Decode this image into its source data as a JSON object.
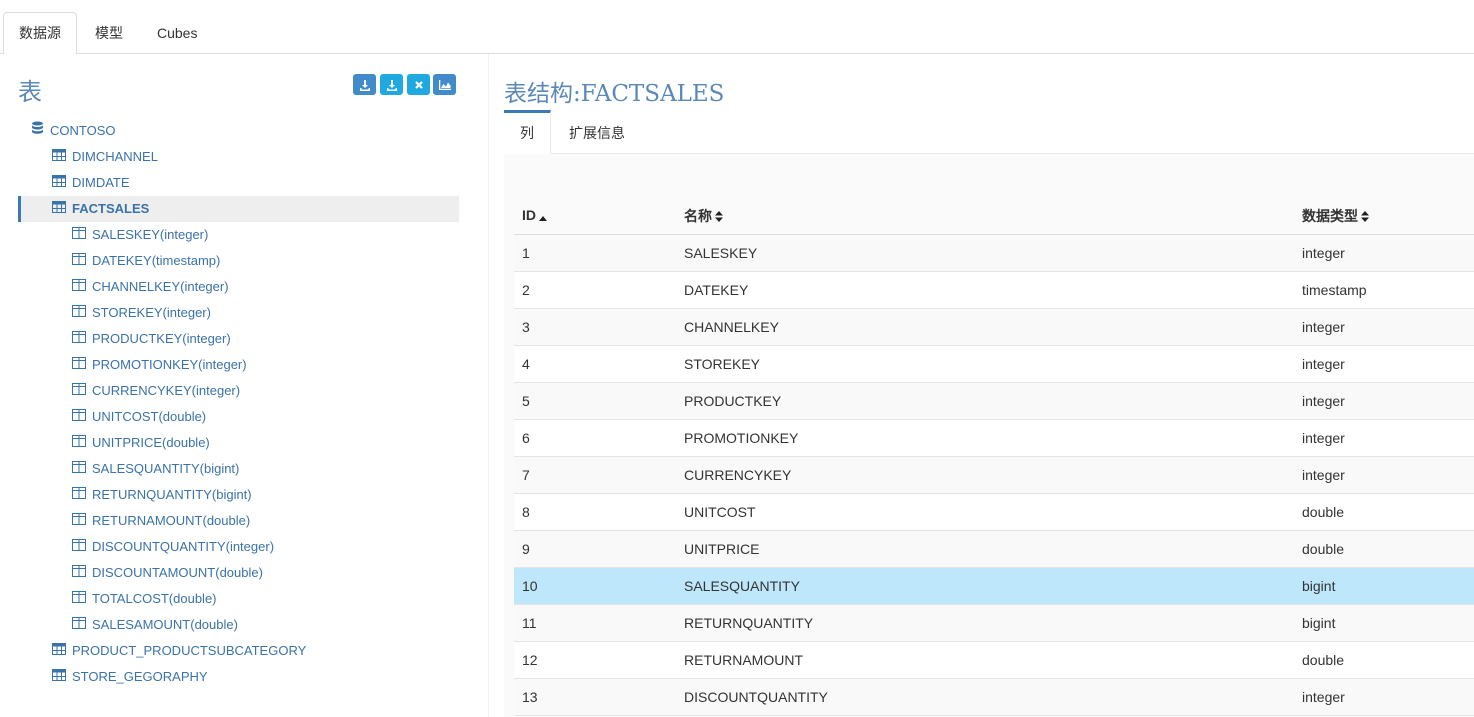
{
  "top_tabs": [
    "数据源",
    "模型",
    "Cubes"
  ],
  "left": {
    "title": "表",
    "toolbar": [
      {
        "name": "import-button",
        "color": "#428bca",
        "icon": "download-icon"
      },
      {
        "name": "download-button",
        "color": "#1fa9e0",
        "icon": "download-icon"
      },
      {
        "name": "delete-button",
        "color": "#1fa9e0",
        "icon": "close-icon"
      },
      {
        "name": "chart-button",
        "color": "#428bca",
        "icon": "area-chart-icon"
      }
    ],
    "tree": {
      "database": "CONTOSO",
      "tables_before": [
        "DIMCHANNEL",
        "DIMDATE"
      ],
      "selected_table": "FACTSALES",
      "columns": [
        "SALESKEY(integer)",
        "DATEKEY(timestamp)",
        "CHANNELKEY(integer)",
        "STOREKEY(integer)",
        "PRODUCTKEY(integer)",
        "PROMOTIONKEY(integer)",
        "CURRENCYKEY(integer)",
        "UNITCOST(double)",
        "UNITPRICE(double)",
        "SALESQUANTITY(bigint)",
        "RETURNQUANTITY(bigint)",
        "RETURNAMOUNT(double)",
        "DISCOUNTQUANTITY(integer)",
        "DISCOUNTAMOUNT(double)",
        "TOTALCOST(double)",
        "SALESAMOUNT(double)"
      ],
      "tables_after": [
        "PRODUCT_PRODUCTSUBCATEGORY",
        "STORE_GEGORAPHY"
      ]
    }
  },
  "right": {
    "title": "表结构:FACTSALES",
    "tabs": [
      "列",
      "扩展信息"
    ],
    "table": {
      "headers": [
        "ID",
        "名称",
        "数据类型"
      ],
      "highlight_row": 10,
      "rows": [
        [
          "1",
          "SALESKEY",
          "integer"
        ],
        [
          "2",
          "DATEKEY",
          "timestamp"
        ],
        [
          "3",
          "CHANNELKEY",
          "integer"
        ],
        [
          "4",
          "STOREKEY",
          "integer"
        ],
        [
          "5",
          "PRODUCTKEY",
          "integer"
        ],
        [
          "6",
          "PROMOTIONKEY",
          "integer"
        ],
        [
          "7",
          "CURRENCYKEY",
          "integer"
        ],
        [
          "8",
          "UNITCOST",
          "double"
        ],
        [
          "9",
          "UNITPRICE",
          "double"
        ],
        [
          "10",
          "SALESQUANTITY",
          "bigint"
        ],
        [
          "11",
          "RETURNQUANTITY",
          "bigint"
        ],
        [
          "12",
          "RETURNAMOUNT",
          "double"
        ],
        [
          "13",
          "DISCOUNTQUANTITY",
          "integer"
        ]
      ]
    }
  },
  "colors": {
    "accent": "#3a7ab8",
    "link": "#3a73a8",
    "title": "#5a88b8",
    "highlight": "#bfe7fb"
  }
}
